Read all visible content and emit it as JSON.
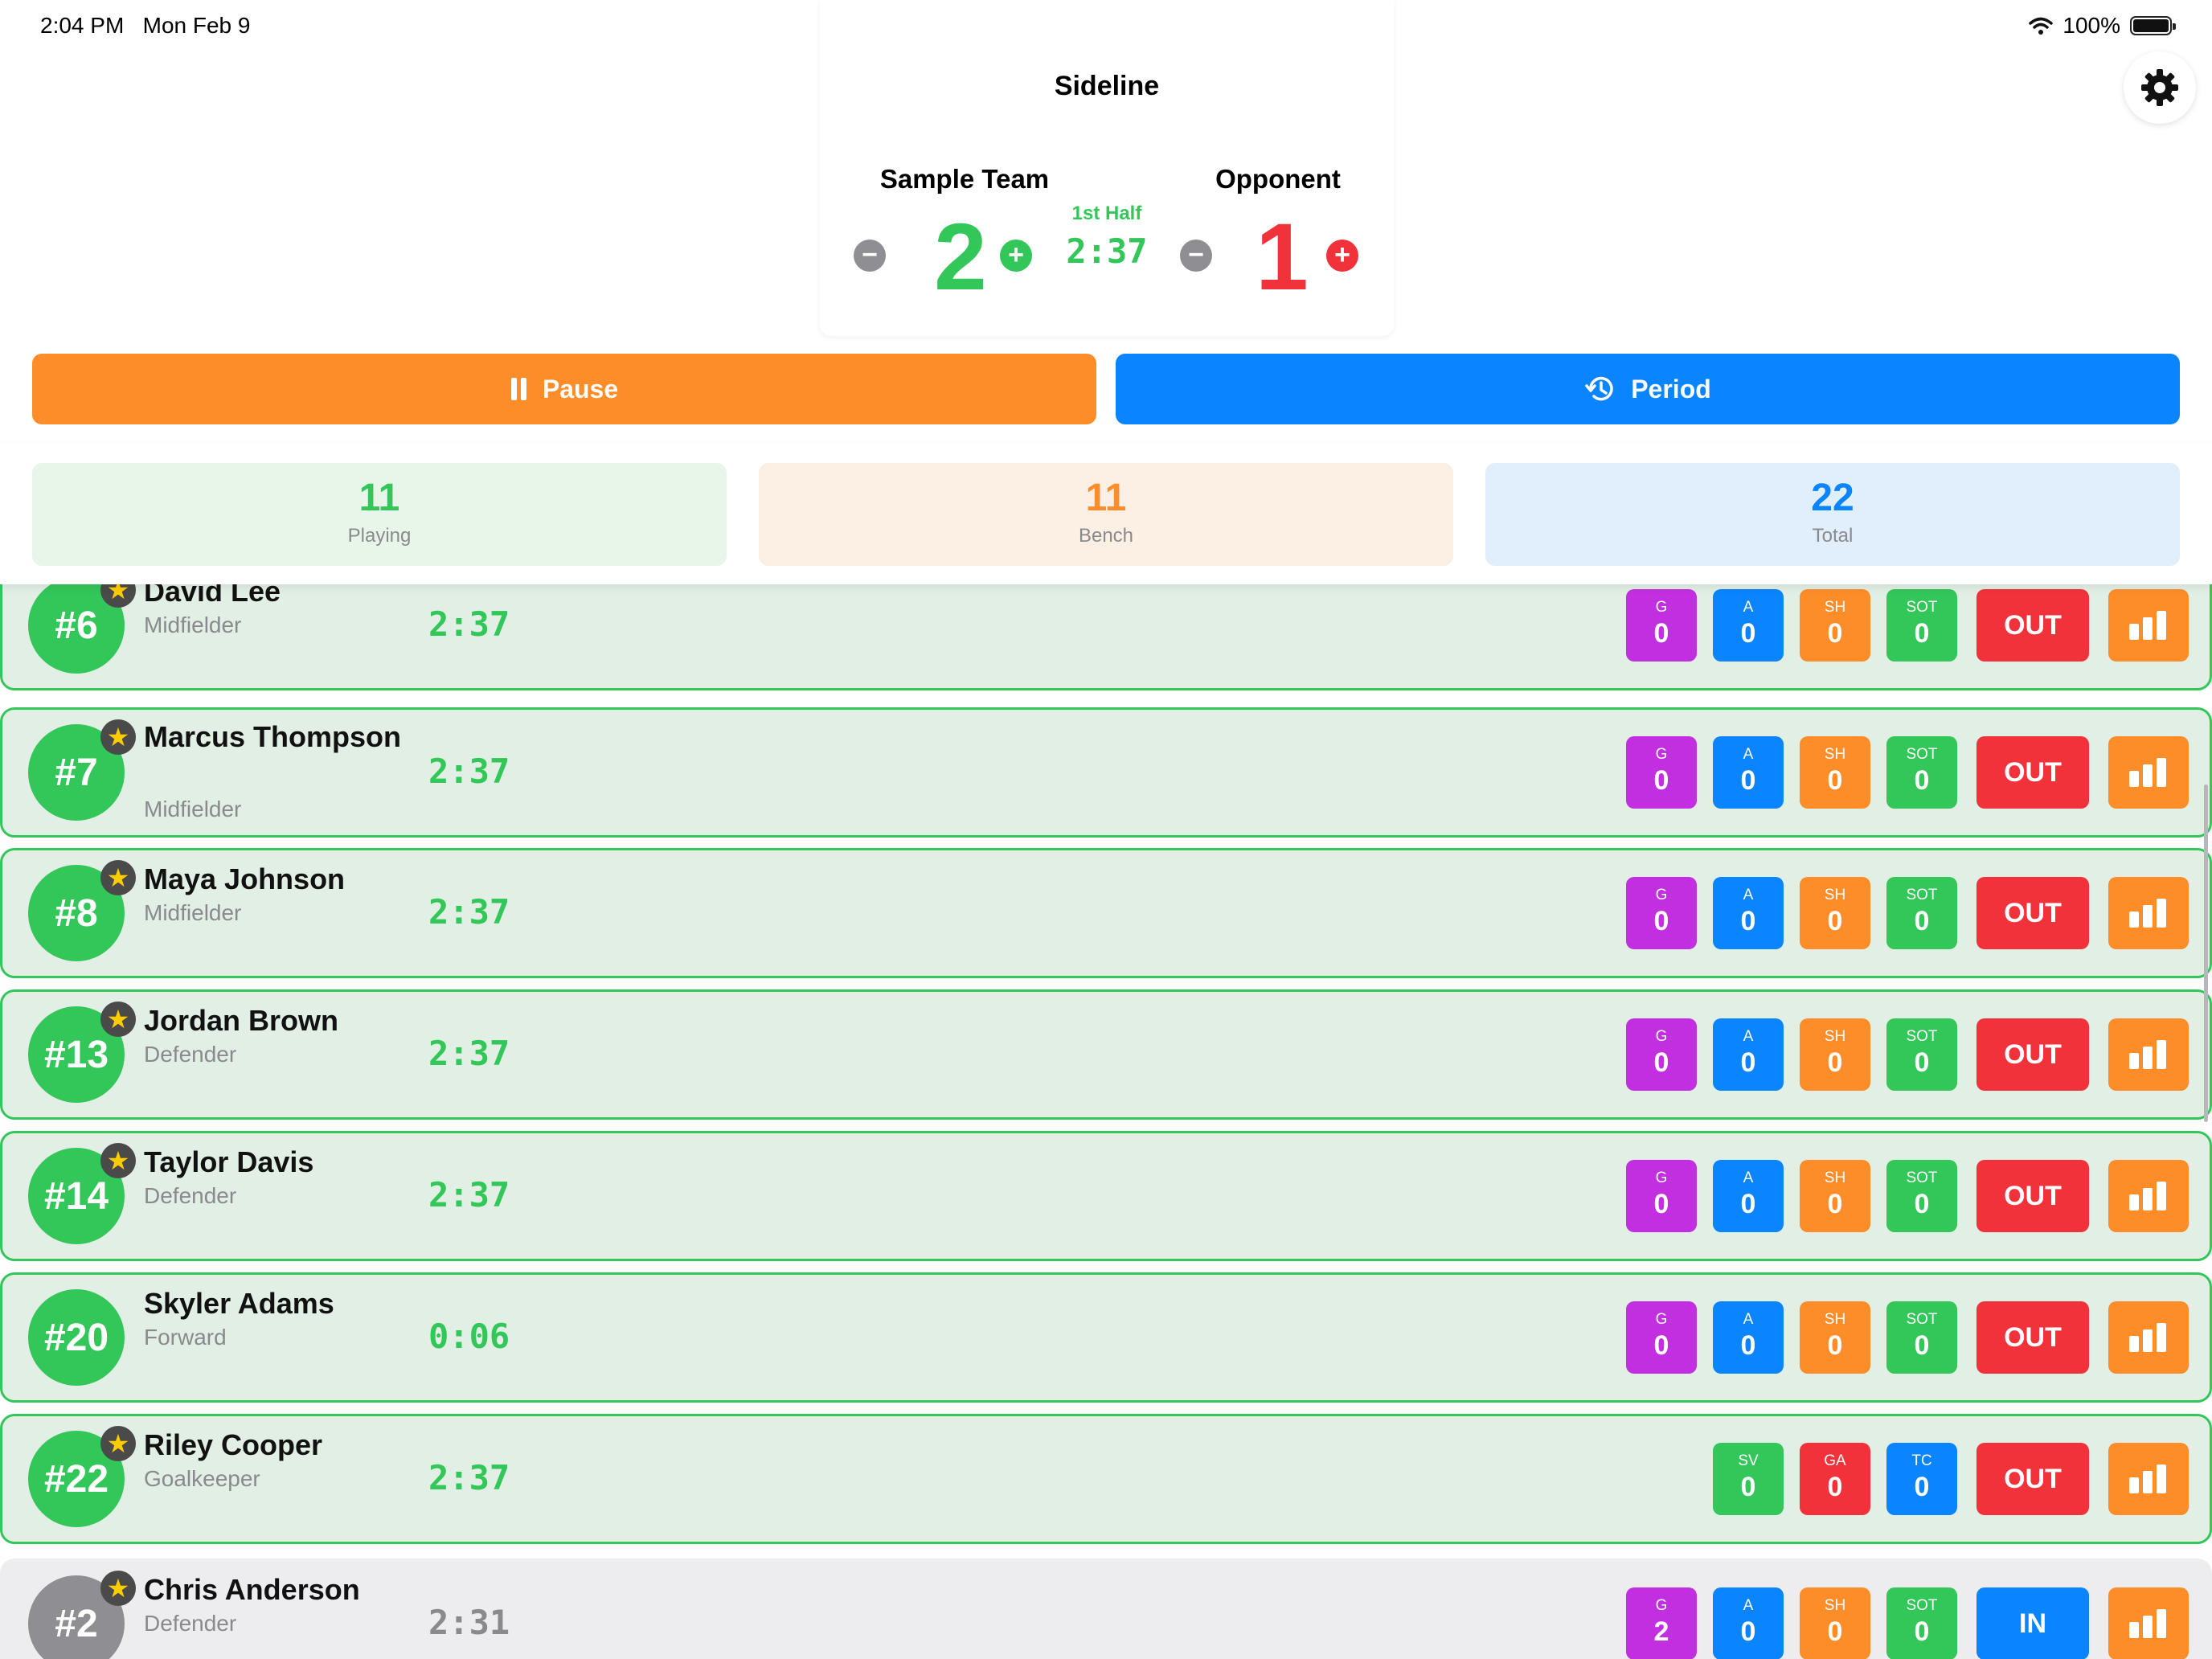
{
  "status_bar": {
    "time": "2:04 PM",
    "date": "Mon Feb 9",
    "battery": "100%"
  },
  "app_title": "Sideline",
  "scoreboard": {
    "home": {
      "name": "Sample Team",
      "score": "2"
    },
    "away": {
      "name": "Opponent",
      "score": "1"
    },
    "period": "1st Half",
    "clock": "2:37"
  },
  "icons": {
    "settings": "gear-icon",
    "pause": "pause-icon",
    "period": "history-icon",
    "stats": "bar-chart-icon",
    "starter": "star-icon"
  },
  "actions": {
    "pause_label": "Pause",
    "period_label": "Period"
  },
  "summary": {
    "playing": {
      "value": "11",
      "label": "Playing"
    },
    "bench": {
      "value": "11",
      "label": "Bench"
    },
    "total": {
      "value": "22",
      "label": "Total"
    }
  },
  "colors": {
    "green": "#33c659",
    "orange": "#fd8d28",
    "blue": "#0a84ff",
    "red": "#f2323b",
    "purple": "#c22fe0"
  },
  "players": [
    {
      "number": "#6",
      "name": "David Lee",
      "position": "Midfielder",
      "time": "2:37",
      "status": "playing",
      "starter": true,
      "toggle": "OUT",
      "stats": [
        {
          "label": "G",
          "value": "0",
          "color": "purple"
        },
        {
          "label": "A",
          "value": "0",
          "color": "blue"
        },
        {
          "label": "SH",
          "value": "0",
          "color": "orange"
        },
        {
          "label": "SOT",
          "value": "0",
          "color": "green"
        }
      ]
    },
    {
      "number": "#7",
      "name": "Marcus Thompson",
      "position": "Midfielder",
      "time": "2:37",
      "status": "playing",
      "starter": true,
      "toggle": "OUT",
      "stats": [
        {
          "label": "G",
          "value": "0",
          "color": "purple"
        },
        {
          "label": "A",
          "value": "0",
          "color": "blue"
        },
        {
          "label": "SH",
          "value": "0",
          "color": "orange"
        },
        {
          "label": "SOT",
          "value": "0",
          "color": "green"
        }
      ]
    },
    {
      "number": "#8",
      "name": "Maya Johnson",
      "position": "Midfielder",
      "time": "2:37",
      "status": "playing",
      "starter": true,
      "toggle": "OUT",
      "stats": [
        {
          "label": "G",
          "value": "0",
          "color": "purple"
        },
        {
          "label": "A",
          "value": "0",
          "color": "blue"
        },
        {
          "label": "SH",
          "value": "0",
          "color": "orange"
        },
        {
          "label": "SOT",
          "value": "0",
          "color": "green"
        }
      ]
    },
    {
      "number": "#13",
      "name": "Jordan Brown",
      "position": "Defender",
      "time": "2:37",
      "status": "playing",
      "starter": true,
      "toggle": "OUT",
      "stats": [
        {
          "label": "G",
          "value": "0",
          "color": "purple"
        },
        {
          "label": "A",
          "value": "0",
          "color": "blue"
        },
        {
          "label": "SH",
          "value": "0",
          "color": "orange"
        },
        {
          "label": "SOT",
          "value": "0",
          "color": "green"
        }
      ]
    },
    {
      "number": "#14",
      "name": "Taylor Davis",
      "position": "Defender",
      "time": "2:37",
      "status": "playing",
      "starter": true,
      "toggle": "OUT",
      "stats": [
        {
          "label": "G",
          "value": "0",
          "color": "purple"
        },
        {
          "label": "A",
          "value": "0",
          "color": "blue"
        },
        {
          "label": "SH",
          "value": "0",
          "color": "orange"
        },
        {
          "label": "SOT",
          "value": "0",
          "color": "green"
        }
      ]
    },
    {
      "number": "#20",
      "name": "Skyler Adams",
      "position": "Forward",
      "time": "0:06",
      "status": "playing",
      "starter": false,
      "toggle": "OUT",
      "stats": [
        {
          "label": "G",
          "value": "0",
          "color": "purple"
        },
        {
          "label": "A",
          "value": "0",
          "color": "blue"
        },
        {
          "label": "SH",
          "value": "0",
          "color": "orange"
        },
        {
          "label": "SOT",
          "value": "0",
          "color": "green"
        }
      ]
    },
    {
      "number": "#22",
      "name": "Riley Cooper",
      "position": "Goalkeeper",
      "time": "2:37",
      "status": "playing",
      "starter": true,
      "toggle": "OUT",
      "stats": [
        {
          "label": "SV",
          "value": "0",
          "color": "green"
        },
        {
          "label": "GA",
          "value": "0",
          "color": "red"
        },
        {
          "label": "TC",
          "value": "0",
          "color": "blue"
        }
      ]
    },
    {
      "number": "#2",
      "name": "Chris Anderson",
      "position": "Defender",
      "time": "2:31",
      "status": "bench",
      "starter": true,
      "toggle": "IN",
      "stats": [
        {
          "label": "G",
          "value": "2",
          "color": "purple"
        },
        {
          "label": "A",
          "value": "0",
          "color": "blue"
        },
        {
          "label": "SH",
          "value": "0",
          "color": "orange"
        },
        {
          "label": "SOT",
          "value": "0",
          "color": "green"
        }
      ]
    }
  ]
}
